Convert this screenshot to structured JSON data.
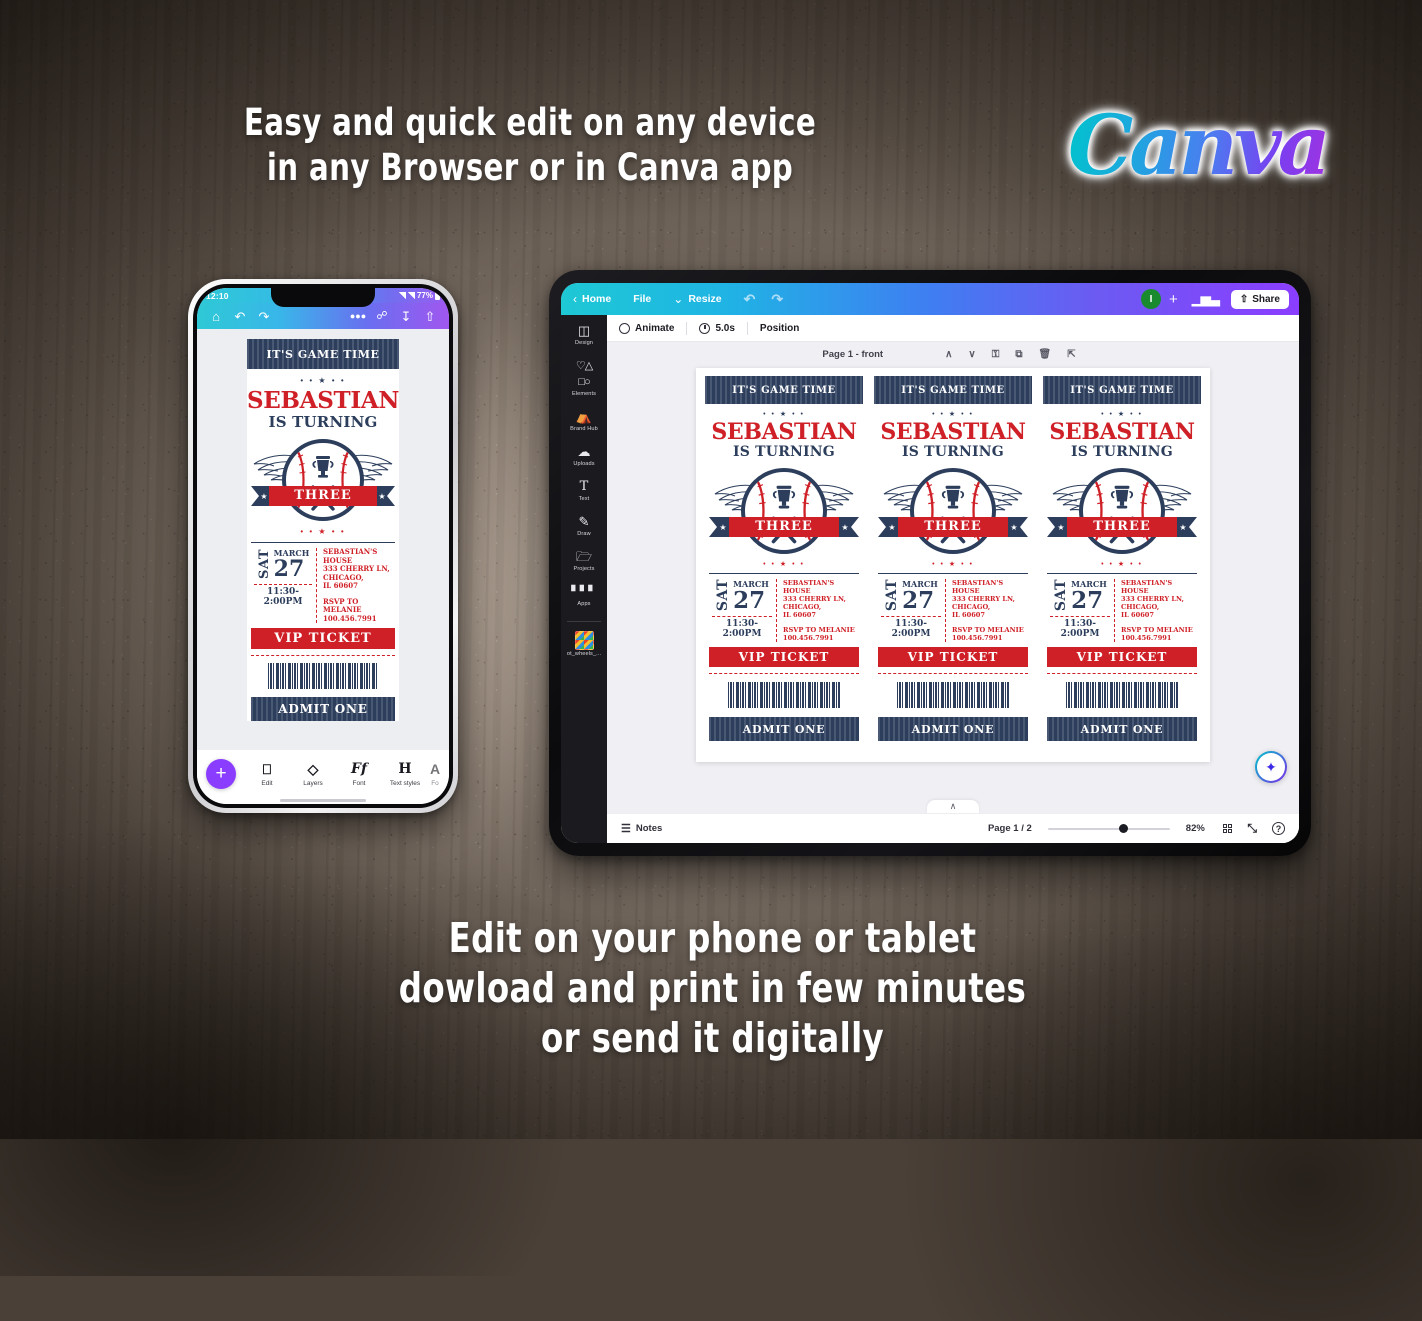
{
  "headline": {
    "line1": "Easy and quick edit on any device",
    "line2": "in any Browser or in Canva app"
  },
  "footer": {
    "line1": "Edit on your phone or tablet",
    "line2": "dowload and print in few minutes",
    "line3": "or send it digitally"
  },
  "brand": {
    "name": "Canva",
    "gradient_from": "#00c4cc",
    "gradient_to": "#b52bd8"
  },
  "colors": {
    "navy": "#2c3e5c",
    "red": "#cf2027",
    "purple": "#8b3dff",
    "teal": "#00c4cc",
    "avatar_green": "#1a8a2e"
  },
  "phone": {
    "status": {
      "time": "12:10",
      "battery": "77%"
    },
    "toolbar": [
      {
        "name": "home-icon",
        "glyph": "⌂"
      },
      {
        "name": "undo-icon",
        "glyph": "↶"
      },
      {
        "name": "redo-icon",
        "glyph": "↷"
      },
      {
        "name": "more-icon",
        "glyph": "•••"
      },
      {
        "name": "link-icon",
        "glyph": "🔗"
      },
      {
        "name": "download-icon",
        "glyph": "↓"
      },
      {
        "name": "share-icon",
        "glyph": "⇧"
      }
    ],
    "bottom": {
      "add_label": "+",
      "tools": [
        {
          "label": "Edit",
          "glyph": "⌨"
        },
        {
          "label": "Layers",
          "glyph": "≣"
        },
        {
          "label": "Font",
          "glyph": "Ff"
        },
        {
          "label": "Text styles",
          "glyph": "H"
        },
        {
          "label": "Fo",
          "glyph": "A"
        }
      ]
    }
  },
  "tablet": {
    "topbar": {
      "back_label": "Home",
      "file_label": "File",
      "resize_label": "Resize",
      "undo_glyph": "↶",
      "redo_glyph": "↷",
      "avatar_initial": "I",
      "add_glyph": "+",
      "insights_glyph": "█",
      "share_label": "Share",
      "share_glyph": "↑"
    },
    "sidebar": [
      {
        "label": "Design",
        "icon": "design-icon",
        "glyph": "◱"
      },
      {
        "label": "Elements",
        "icon": "elements-icon",
        "glyph": "⬡"
      },
      {
        "label": "Brand Hub",
        "icon": "brand-hub-icon",
        "glyph": "⌂"
      },
      {
        "label": "Uploads",
        "icon": "uploads-icon",
        "glyph": "☁"
      },
      {
        "label": "Text",
        "icon": "text-icon",
        "glyph": "T"
      },
      {
        "label": "Draw",
        "icon": "draw-icon",
        "glyph": "✎"
      },
      {
        "label": "Projects",
        "icon": "projects-icon",
        "glyph": "🗀"
      },
      {
        "label": "Apps",
        "icon": "apps-icon",
        "glyph": "⠿"
      }
    ],
    "sidebar_project": {
      "label": "ot_wheels_..."
    },
    "contextbar": {
      "animate_label": "Animate",
      "duration_label": "5.0s",
      "position_label": "Position"
    },
    "page_header": {
      "label": "Page 1 - front",
      "icons": [
        {
          "name": "move-up-icon",
          "glyph": "∧"
        },
        {
          "name": "move-down-icon",
          "glyph": "∨"
        },
        {
          "name": "lock-icon",
          "glyph": "⚿"
        },
        {
          "name": "duplicate-icon",
          "glyph": "⧉"
        },
        {
          "name": "delete-icon",
          "glyph": "Ὕ1"
        },
        {
          "name": "add-page-icon",
          "glyph": "⇥"
        }
      ]
    },
    "bottombar": {
      "notes_label": "Notes",
      "page_label": "Page 1 / 2",
      "zoom_label": "82%",
      "zoom_value": 82,
      "grid_icon": "grid-view-icon",
      "fullscreen_glyph": "⤡",
      "help_glyph": "?"
    },
    "magic_button": {
      "name": "magic-studio-icon",
      "glyph": "✦"
    }
  },
  "ticket": {
    "header": "IT'S GAME TIME",
    "name": "SEBASTIAN",
    "turning": "IS TURNING",
    "age": "THREE",
    "weekday": "SAT",
    "month": "MARCH",
    "day": "27",
    "time": "11:30-\n2:00PM",
    "time_line1": "11:30-",
    "time_line2": "2:00PM",
    "venue": "SEBASTIAN'S HOUSE",
    "street": "333 CHERRY LN,",
    "city": "CHICAGO,",
    "zip": "IL 60607",
    "rsvp_label": "RSVP TO MELANIE",
    "rsvp_phone": "100.456.7991",
    "vip": "VIP TICKET",
    "admit": "ADMIT ONE",
    "stars": "• • ★ • •"
  }
}
